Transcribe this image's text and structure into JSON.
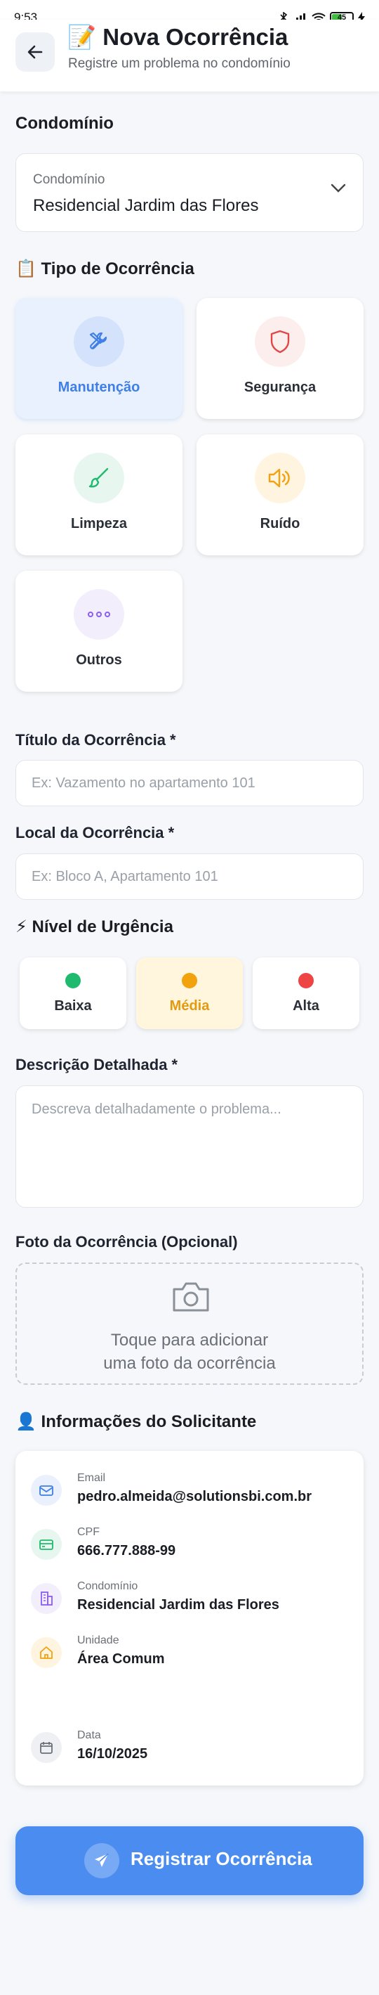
{
  "status_bar": {
    "time": "9:53",
    "battery": "45"
  },
  "header": {
    "title": "📝 Nova Ocorrência",
    "subtitle": "Registre um problema no condomínio"
  },
  "condominio": {
    "section_title": "Condomínio",
    "select_label": "Condomínio",
    "select_value": "Residencial Jardim das Flores"
  },
  "tipo": {
    "section_title": "📋 Tipo de Ocorrência",
    "options": [
      {
        "label": "Manutenção",
        "icon": "tools-icon",
        "selected": true
      },
      {
        "label": "Segurança",
        "icon": "shield-icon",
        "selected": false
      },
      {
        "label": "Limpeza",
        "icon": "brush-icon",
        "selected": false
      },
      {
        "label": "Ruído",
        "icon": "speaker-icon",
        "selected": false
      },
      {
        "label": "Outros",
        "icon": "more-icon",
        "selected": false
      }
    ]
  },
  "titulo": {
    "label": "Título da Ocorrência *",
    "placeholder": "Ex: Vazamento no apartamento 101"
  },
  "local": {
    "label": "Local da Ocorrência *",
    "placeholder": "Ex: Bloco A, Apartamento 101"
  },
  "urgencia": {
    "section_title": "⚡ Nível de Urgência",
    "options": [
      {
        "label": "Baixa",
        "color": "#1fba6e",
        "selected": false
      },
      {
        "label": "Média",
        "color": "#f2a20c",
        "selected": true
      },
      {
        "label": "Alta",
        "color": "#ef4444",
        "selected": false
      }
    ]
  },
  "descricao": {
    "label": "Descrição Detalhada *",
    "placeholder": "Descreva detalhadamente o problema..."
  },
  "foto": {
    "label": "Foto da Ocorrência (Opcional)",
    "line1": "Toque para adicionar",
    "line2": "uma foto da ocorrência"
  },
  "solicitante": {
    "section_title": "👤 Informações do Solicitante",
    "rows": [
      {
        "label": "Email",
        "value": "pedro.almeida@solutionsbi.com.br",
        "icon": "mail-icon"
      },
      {
        "label": "CPF",
        "value": "666.777.888-99",
        "icon": "card-icon"
      },
      {
        "label": "Condomínio",
        "value": "Residencial Jardim das Flores",
        "icon": "building-icon"
      },
      {
        "label": "Unidade",
        "value": "Área Comum",
        "icon": "home-icon"
      },
      {
        "label": "Data",
        "value": "16/10/2025",
        "icon": "calendar-icon"
      }
    ]
  },
  "submit": {
    "label": "Registrar Ocorrência"
  },
  "colors": {
    "accent": "#4a8cf0",
    "active_type_bg": "#e9f1fe",
    "active_urgency_bg": "#fff6dd"
  }
}
